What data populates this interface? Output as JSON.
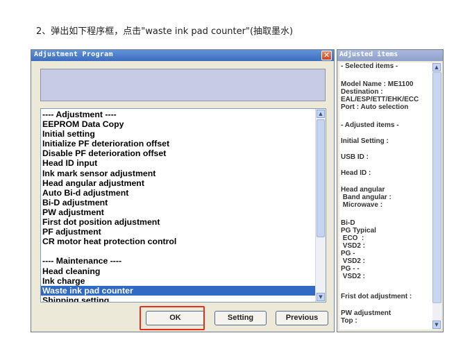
{
  "caption": "2、弹出如下程序框，点击\"waste ink pad counter\"(抽取墨水)",
  "dialog": {
    "title": "Adjustment Program",
    "close_glyph": "✕",
    "list_items": [
      "---- Adjustment ----",
      "EEPROM Data Copy",
      "Initial setting",
      "Initialize PF deterioration offset",
      "Disable PF deterioration offset",
      "Head ID input",
      "Ink mark sensor adjustment",
      "Head angular adjustment",
      "Auto Bi-d adjustment",
      "Bi-D adjustment",
      "PW adjustment",
      "First dot position adjustment",
      "PF adjustment",
      "CR motor heat protection control",
      "",
      "---- Maintenance ----",
      "Head cleaning",
      "Ink charge",
      "Waste ink pad counter",
      "Shipping setting"
    ],
    "selected_item": "Waste ink pad counter",
    "buttons": {
      "ok": "OK",
      "setting": "Setting",
      "previous": "Previous"
    }
  },
  "panel": {
    "title": "Adjusted items",
    "lines": [
      "- Selected items -",
      "",
      "Model Name : ME1100",
      "Destination :",
      "EAL/ESP/ETT/EHK/ECC",
      "Port : Auto selection",
      "",
      "- Adjusted items -",
      "",
      "Initial Setting :",
      "",
      "USB ID :",
      "",
      "Head ID :",
      "",
      "Head angular",
      " Band angular :",
      " Microwave :",
      "",
      "Bi-D",
      "PG Typical",
      " ECO  :",
      " VSD2 :",
      "PG -",
      " VSD2 :",
      "PG - -",
      " VSD2 :",
      "",
      "Frist dot adjustment :",
      "",
      "PW adjustment",
      "Top :"
    ]
  },
  "colors": {
    "selection": "#316ac5",
    "highlight_box": "#e03020",
    "titlebar": "#3c6cc0"
  },
  "icons": [
    "close-icon",
    "scroll-up-arrow-icon",
    "scroll-down-arrow-icon"
  ]
}
